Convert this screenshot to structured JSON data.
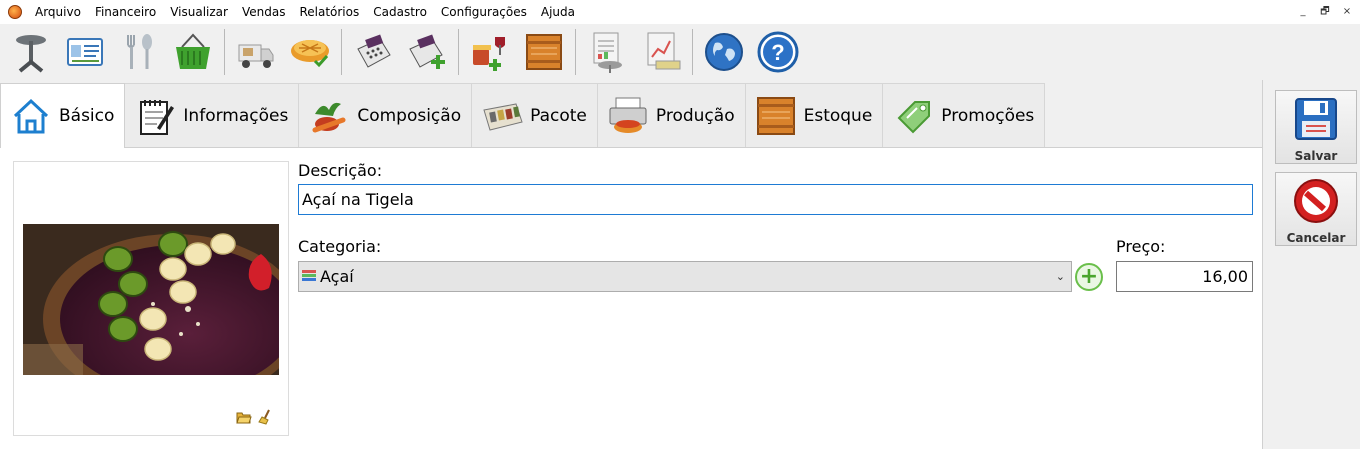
{
  "menu": {
    "items": [
      "Arquivo",
      "Financeiro",
      "Visualizar",
      "Vendas",
      "Relatórios",
      "Cadastro",
      "Configurações",
      "Ajuda"
    ],
    "window_controls": [
      "_",
      "🗗",
      "×"
    ]
  },
  "toolbar": {
    "icons": [
      "table-icon",
      "customer-card-icon",
      "cutlery-icon",
      "basket-icon",
      "delivery-truck-icon",
      "pie-check-icon",
      "cash-register-icon",
      "cash-register-add-icon",
      "food-add-icon",
      "stock-crate-icon",
      "report-table-icon",
      "report-chart-icon",
      "globe-icon",
      "help-icon"
    ]
  },
  "tabs": [
    {
      "label": "Básico",
      "icon": "home-icon",
      "active": true
    },
    {
      "label": "Informações",
      "icon": "notepad-icon",
      "active": false
    },
    {
      "label": "Composição",
      "icon": "vegetables-icon",
      "active": false
    },
    {
      "label": "Pacote",
      "icon": "package-icon",
      "active": false
    },
    {
      "label": "Produção",
      "icon": "printer-cake-icon",
      "active": false
    },
    {
      "label": "Estoque",
      "icon": "crate-icon",
      "active": false
    },
    {
      "label": "Promoções",
      "icon": "price-tag-icon",
      "active": false
    }
  ],
  "form": {
    "descricao_label": "Descrição:",
    "descricao_value": "Açaí na Tigela",
    "categoria_label": "Categoria:",
    "categoria_value": "Açaí",
    "preco_label": "Preço:",
    "preco_value": "16,00"
  },
  "actions": {
    "save_label": "Salvar",
    "cancel_label": "Cancelar"
  },
  "colors": {
    "accent": "#1e7bd4",
    "add_green": "#4aa52e",
    "cancel_red": "#d32020"
  }
}
